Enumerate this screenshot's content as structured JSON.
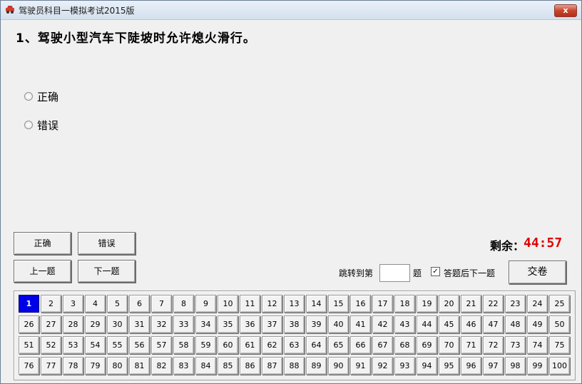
{
  "window": {
    "title": "驾驶员科目一模拟考试2015版",
    "close_label": "x"
  },
  "question": {
    "text": "1、驾驶小型汽车下陡坡时允许熄火滑行。"
  },
  "options": [
    {
      "label": "正确"
    },
    {
      "label": "错误"
    }
  ],
  "buttons": {
    "correct": "正确",
    "wrong": "错误",
    "prev": "上一题",
    "next": "下一题",
    "submit": "交卷"
  },
  "timer": {
    "label": "剩余：",
    "value": "44:57"
  },
  "jump": {
    "label_before": "跳转到第",
    "label_after": "题",
    "value": ""
  },
  "auto_next": {
    "label": "答题后下一题",
    "checked": true
  },
  "question_grid": {
    "current": 1,
    "numbers": [
      1,
      2,
      3,
      4,
      5,
      6,
      7,
      8,
      9,
      10,
      11,
      12,
      13,
      14,
      15,
      16,
      17,
      18,
      19,
      20,
      21,
      22,
      23,
      24,
      25,
      26,
      27,
      28,
      29,
      30,
      31,
      32,
      33,
      34,
      35,
      36,
      37,
      38,
      39,
      40,
      41,
      42,
      43,
      44,
      45,
      46,
      47,
      48,
      49,
      50,
      51,
      52,
      53,
      54,
      55,
      56,
      57,
      58,
      59,
      60,
      61,
      62,
      63,
      64,
      65,
      66,
      67,
      68,
      69,
      70,
      71,
      72,
      73,
      74,
      75,
      76,
      77,
      78,
      79,
      80,
      81,
      82,
      83,
      84,
      85,
      86,
      87,
      88,
      89,
      90,
      91,
      92,
      93,
      94,
      95,
      96,
      97,
      98,
      99,
      100
    ]
  },
  "colors": {
    "timer": "#e00000",
    "current_question": "#0000e8"
  }
}
